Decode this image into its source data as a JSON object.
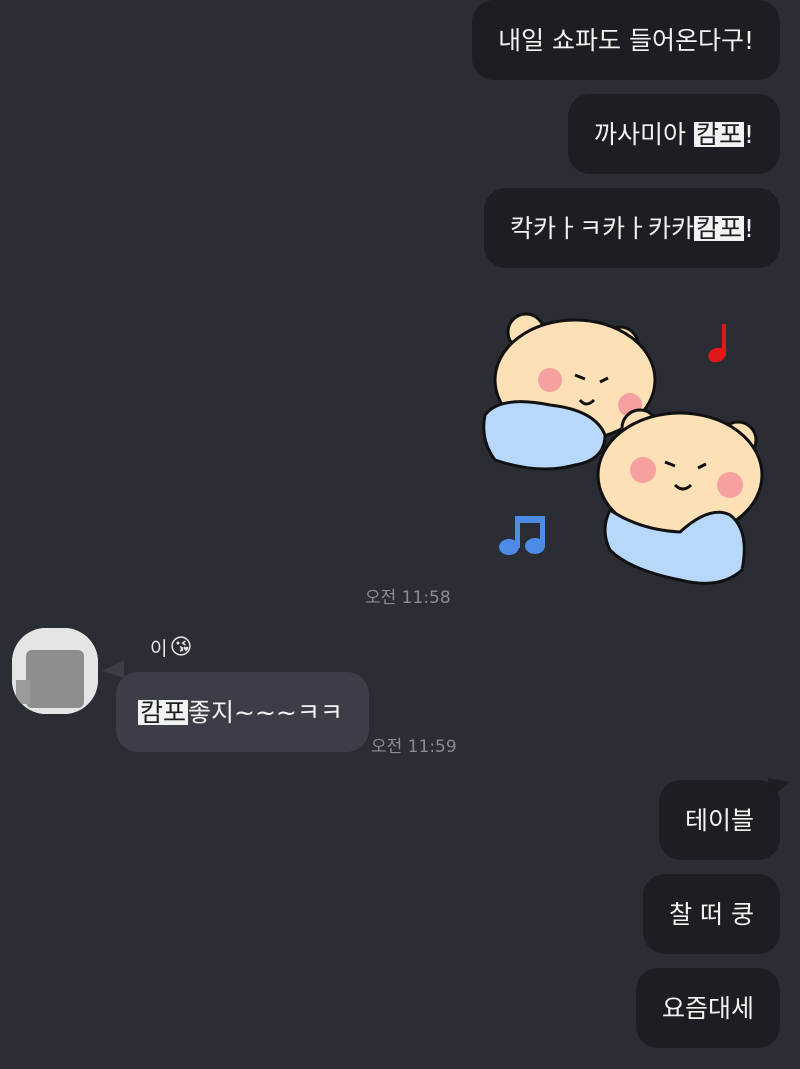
{
  "messages_out_top": [
    {
      "parts": [
        "내일 쇼파도 들어온다구!"
      ]
    },
    {
      "before": "까사미아 ",
      "hl": "캄포",
      "after": "!"
    },
    {
      "before": "칵카ㅏㅋ카ㅏ카카",
      "hl": "캄포",
      "after": "!"
    }
  ],
  "sticker": {
    "icon": "bears-music-sticker"
  },
  "time_sticker": "오전 11:58",
  "incoming": {
    "sender_name": "이",
    "sender_emoji": "😘",
    "message": {
      "hl": "캄포",
      "after": "좋지~~~ㅋㅋ"
    },
    "time": "오전 11:59"
  },
  "messages_out_bottom": [
    "테이블",
    "찰 떠 쿵",
    "요즘대세"
  ],
  "colors": {
    "background": "#2a2d33",
    "bubble_out": "#1c1e23",
    "bubble_in": "#3b3e46",
    "highlight": "#f2f2f2",
    "time_text": "#8a8d94"
  }
}
